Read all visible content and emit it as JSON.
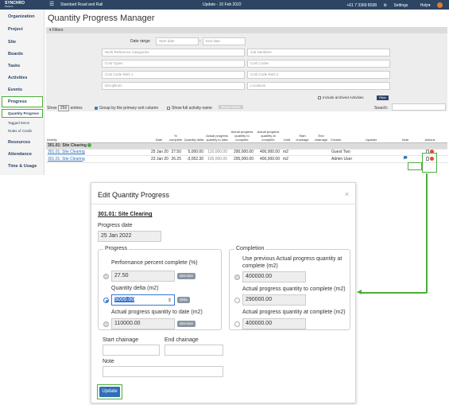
{
  "topbar": {
    "logo_title": "SYNCHRO",
    "logo_sub": "Perform",
    "menu_icon": "hamburger-icon",
    "project": "Standard Road and Rail",
    "center": "Update - 10 Feb 2022",
    "phone": "+61 7 3369 8038",
    "settings": "Settings",
    "help": "Help"
  },
  "sidebar": {
    "items": [
      "Organization",
      "Project",
      "Site",
      "Boards",
      "Tasks",
      "Activities",
      "Events",
      "Progress",
      "Resources",
      "Attendance",
      "Time & Usage"
    ],
    "progress_sub": [
      "Quantity Progress",
      "Tagged Items",
      "Rules of Credit"
    ]
  },
  "main": {
    "title": "Quantity Progress Manager",
    "filters_label": "Filters",
    "date_range_label": "Date range",
    "start_date_placeholder": "Start date",
    "end_date_placeholder": "End date",
    "filter_fields": [
      "Work Reference Categories",
      "Job Numbers",
      "Cost Types",
      "Cost Codes",
      "Cost Code Refs 1",
      "Cost Code Refs 2",
      "Disciplines",
      "Locations"
    ],
    "include_archived": "Include archived Activities",
    "filter_button": "Filter",
    "show_label": "Show",
    "show_value": "250",
    "entries_label": "entries",
    "group_by": "Group by the primary sort column",
    "show_full": "Show full activity name",
    "reset_order": "Reset Order",
    "search_label": "Search:",
    "columns": [
      "Activity",
      "Date",
      "% complete",
      "Quantity delta",
      "Actual progress quantity to date",
      "Actual progress quantity to complete",
      "Actual progress quantity at complete",
      "UoM",
      "Start chainage",
      "End chainage",
      "Creator",
      "Updater",
      "Note",
      "Actions"
    ],
    "group_row": "301.01: Site Clearing",
    "rows": [
      {
        "activity": "301.01: Site Clearing",
        "date": "25 Jan 2022",
        "badge": "delta",
        "pct": "27.50",
        "delta": "5,000.00",
        "to_date": "110,000.00",
        "to_complete": "290,000.00",
        "at_complete": "400,000.00",
        "uom": "m2",
        "creator": "Guest Two"
      },
      {
        "activity": "301.01: Site Clearing",
        "date": "23 Jan 2022",
        "badge": "delta",
        "pct": "26.25",
        "delta": "-3,052.30",
        "to_date": "105,000.00",
        "to_complete": "295,000.00",
        "at_complete": "400,000.00",
        "uom": "m2",
        "creator": "Admin User"
      }
    ]
  },
  "modal": {
    "title": "Edit Quantity Progress",
    "close": "×",
    "activity": "301.01: Site Clearing",
    "progress_date_label": "Progress date",
    "progress_date": "25 Jan 2022",
    "progress_legend": "Progress",
    "pct_label": "Performance percent complete (%)",
    "pct_value": "27.50",
    "pct_badge": "absolute",
    "delta_label": "Quantity delta (m2)",
    "delta_value": "5000.00",
    "delta_badge": "delta",
    "to_date_label": "Actual progress quantity to date (m2)",
    "to_date_value": "110000.00",
    "to_date_badge": "absolute",
    "completion_legend": "Completion",
    "use_prev_label": "Use previous Actual progress quantity at complete (m2)",
    "use_prev_value": "400000.00",
    "to_complete_label": "Actual progress quantity to complete (m2)",
    "to_complete_value": "290000.00",
    "at_complete_label": "Actual progress quantity at complete (m2)",
    "at_complete_value": "400000.00",
    "start_chainage_label": "Start chainage",
    "end_chainage_label": "End chainage",
    "note_label": "Note",
    "update_button": "Update"
  },
  "colors": {
    "accent": "#4cae3a",
    "primary": "#2d6fb8",
    "topbar": "#2d4563"
  }
}
